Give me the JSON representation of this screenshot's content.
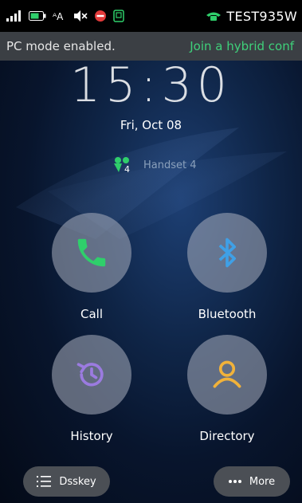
{
  "status_bar": {
    "device_name": "TEST935W"
  },
  "notice": {
    "left_text": "PC mode enabled.",
    "right_text": "Join a hybrid conf"
  },
  "clock": {
    "time": "15:30",
    "date": "Fri, Oct 08"
  },
  "handset": {
    "badge": "4",
    "label": "Handset 4"
  },
  "tiles": [
    {
      "label": "Call",
      "icon": "phone-icon",
      "color": "#2fcf6b"
    },
    {
      "label": "Bluetooth",
      "icon": "bluetooth-icon",
      "color": "#3fa0e6"
    },
    {
      "label": "History",
      "icon": "history-icon",
      "color": "#9b7be0"
    },
    {
      "label": "Directory",
      "icon": "contact-icon",
      "color": "#f1b23a"
    }
  ],
  "bottom": {
    "dsskey_label": "Dsskey",
    "more_label": "More"
  },
  "colors": {
    "notice_accent": "#3fd07a",
    "status_phone_icon": "#2fcf6b"
  }
}
